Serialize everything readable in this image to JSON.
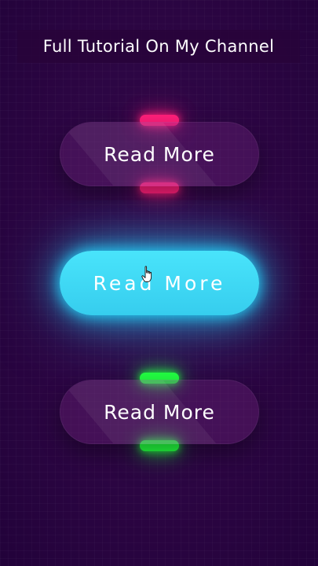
{
  "banner": {
    "title": "Full Tutorial On My Channel"
  },
  "buttons": [
    {
      "label": "Read More",
      "accent_color": "#ff1f7a",
      "state": "default"
    },
    {
      "label": "Read More",
      "accent_color": "#24d8ff",
      "state": "hover"
    },
    {
      "label": "Read More",
      "accent_color": "#23ff3f",
      "state": "default"
    }
  ],
  "colors": {
    "background": "#2c0344",
    "pink_glow": "#ff1f7a",
    "cyan_glow": "#24d8ff",
    "green_glow": "#23ff3f"
  },
  "cursor": {
    "icon": "hand-pointer-icon"
  }
}
